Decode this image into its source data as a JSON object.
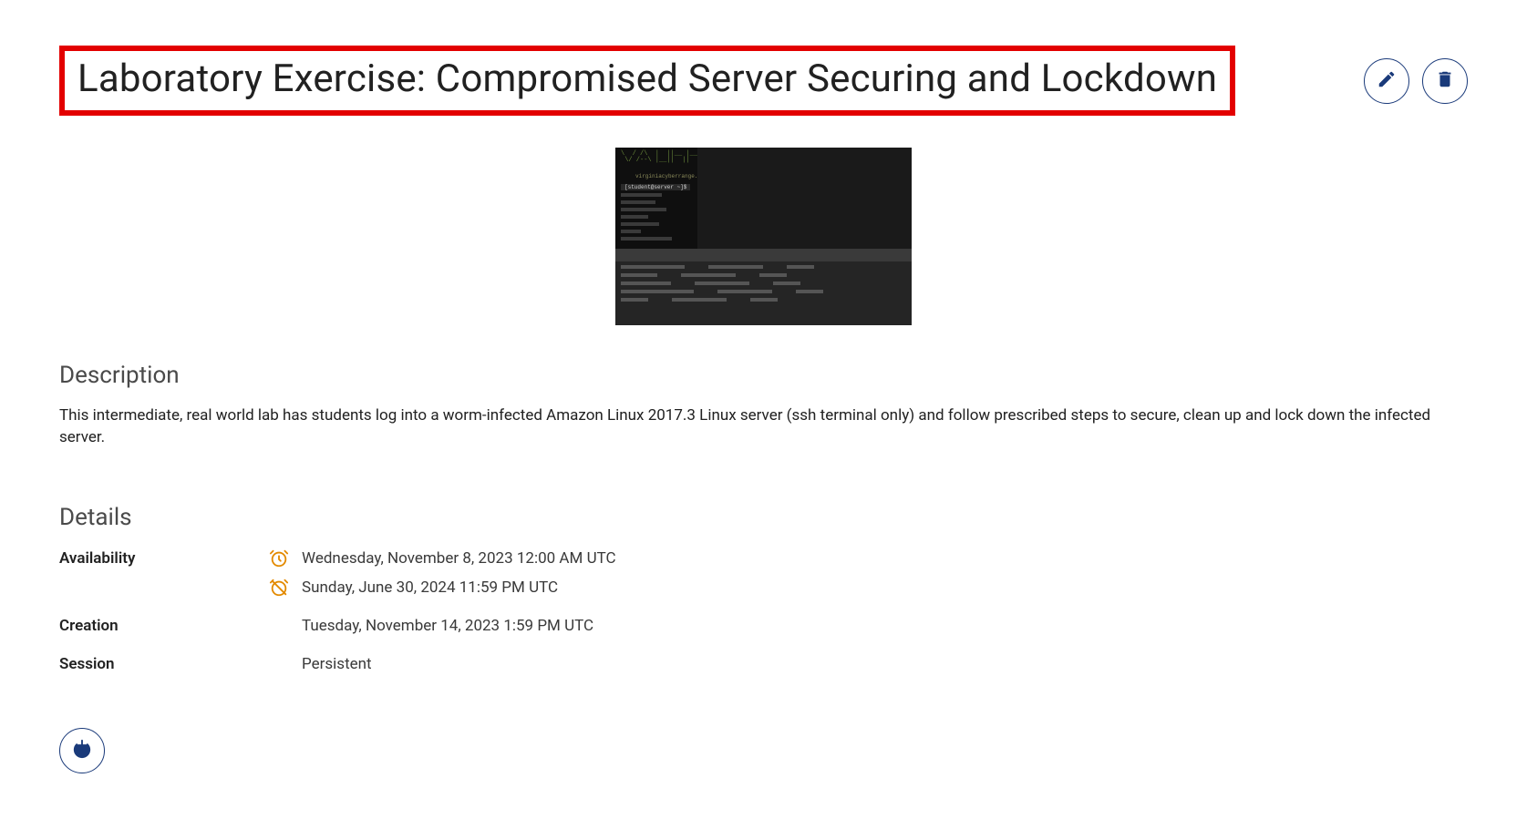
{
  "header": {
    "title": "Laboratory Exercise: Compromised Server Securing and Lockdown"
  },
  "description": {
    "heading": "Description",
    "text": "This intermediate, real world lab has students log into a worm-infected Amazon Linux 2017.3 Linux server (ssh terminal only) and follow prescribed steps to secure, clean up and lock down the infected server."
  },
  "details": {
    "heading": "Details",
    "rows": [
      {
        "label": "Availability",
        "values": [
          {
            "icon": "clock-on",
            "text": "Wednesday, November 8, 2023 12:00 AM UTC"
          },
          {
            "icon": "clock-off",
            "text": "Sunday, June 30, 2024 11:59 PM UTC"
          }
        ]
      },
      {
        "label": "Creation",
        "values": [
          {
            "icon": null,
            "text": "Tuesday, November 14, 2023 1:59 PM UTC"
          }
        ]
      },
      {
        "label": "Session",
        "values": [
          {
            "icon": null,
            "text": "Persistent"
          }
        ]
      }
    ]
  },
  "thumbnail": {
    "url_text": "virginiacyberrange.org",
    "prompt_text": "[student@server ~]$"
  },
  "colors": {
    "accent": "#1a3a7a",
    "highlight_border": "#e30000",
    "icon_warn": "#e38a00"
  }
}
